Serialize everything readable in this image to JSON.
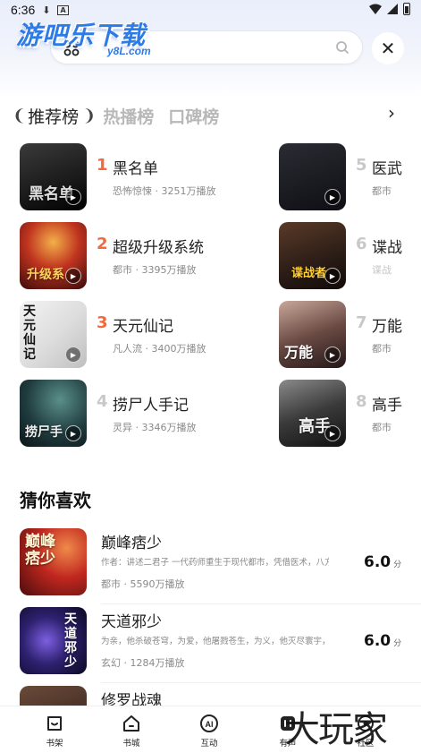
{
  "status_bar": {
    "time": "6:36",
    "icons": [
      "download-icon",
      "a-icon"
    ]
  },
  "header": {
    "logo_text": "游吧乐下载",
    "logo_sub": "y8L.com",
    "search_placeholder": ""
  },
  "ranking": {
    "tabs": [
      "推荐榜",
      "热播榜",
      "口碑榜"
    ],
    "active_tab": "推荐榜",
    "items": [
      {
        "rank": "1",
        "title": "黑名单",
        "meta": "恐怖惊悚 · 3251万播放",
        "cover_text": "黑名单"
      },
      {
        "rank": "2",
        "title": "超级升级系统",
        "meta": "都市 · 3395万播放",
        "cover_text": "升级系"
      },
      {
        "rank": "3",
        "title": "天元仙记",
        "meta": "凡人流 · 3400万播放",
        "cover_text": "天元仙记"
      },
      {
        "rank": "4",
        "title": "捞尸人手记",
        "meta": "灵异 · 3346万播放",
        "cover_text": "捞尸手"
      },
      {
        "rank": "5",
        "title": "医武",
        "meta": "都市",
        "cover_text": ""
      },
      {
        "rank": "6",
        "title": "谍战",
        "meta": "谍战",
        "cover_text": "谍战者"
      },
      {
        "rank": "7",
        "title": "万能",
        "meta": "都市",
        "cover_text": "万能"
      },
      {
        "rank": "8",
        "title": "高手",
        "meta": "都市",
        "cover_text": "高手"
      }
    ]
  },
  "recommend": {
    "section_title": "猜你喜欢",
    "items": [
      {
        "title": "巅峰痞少",
        "desc": "作者：讲述二君子 一代药师重生于现代都市，凭借医术，八方逢...",
        "meta": "都市 · 5590万播放",
        "score": "6.0",
        "score_unit": "分",
        "cover_text": "巅峰痞少"
      },
      {
        "title": "天道邪少",
        "desc": "为亲，他杀破苍穹，为爱，他屠戮苍生，为义，他灭尽寰宇，为...",
        "meta": "玄幻 · 1284万播放",
        "score": "6.0",
        "score_unit": "分",
        "cover_text": "天道邪少"
      },
      {
        "title": "修罗战魂",
        "desc": "",
        "meta": "",
        "score": "",
        "score_unit": "",
        "cover_text": ""
      }
    ]
  },
  "bottom_nav": [
    {
      "label": "书架",
      "icon": "bookshelf-icon"
    },
    {
      "label": "书城",
      "icon": "bookstore-icon"
    },
    {
      "label": "互动",
      "icon": "ai-icon"
    },
    {
      "label": "有声",
      "icon": "audio-icon"
    },
    {
      "label": "社区",
      "icon": "community-icon"
    }
  ],
  "watermark": "大玩家",
  "colors": {
    "accent": "#f06a3d",
    "logo": "#2d7be6",
    "muted": "#8a8a8a"
  }
}
